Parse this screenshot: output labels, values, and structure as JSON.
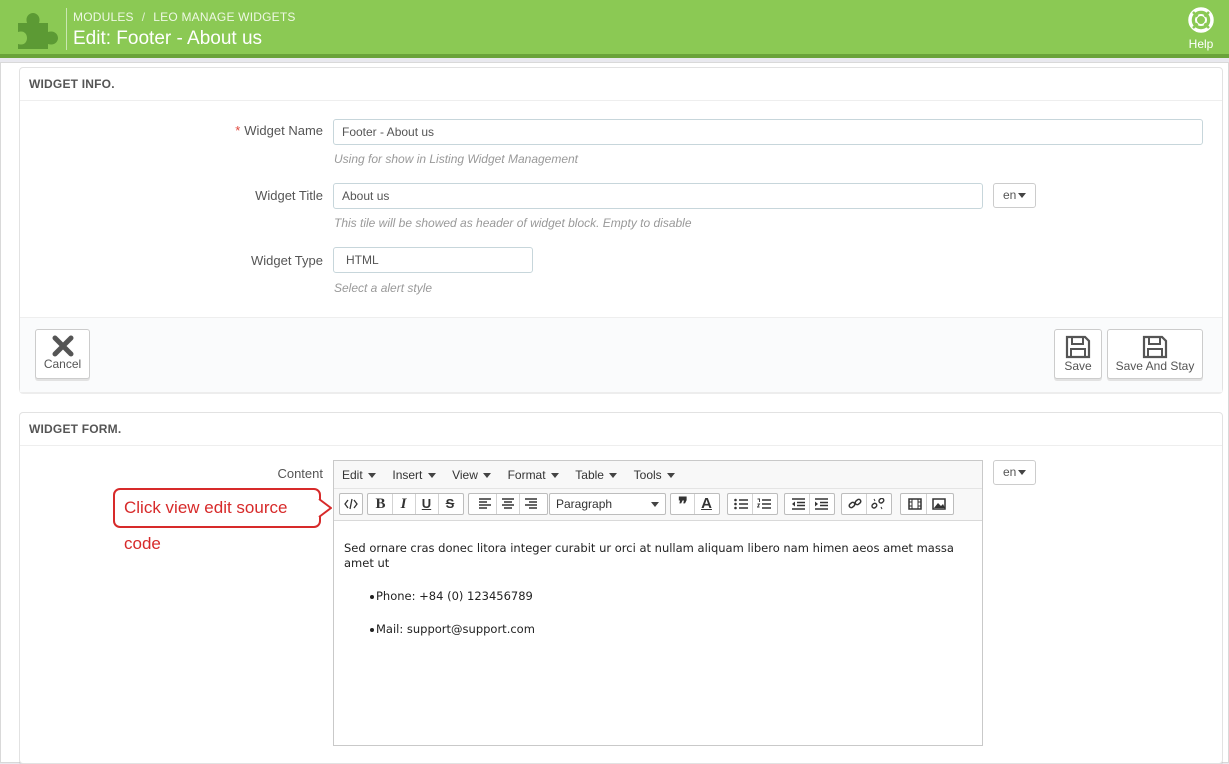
{
  "header": {
    "breadcrumb": [
      "MODULES",
      "LEO MANAGE WIDGETS"
    ],
    "breadcrumb_sep": "/",
    "title": "Edit: Footer - About us",
    "help_label": "Help",
    "bg_color": "#8bc954"
  },
  "widget_info": {
    "heading": "WIDGET INFO.",
    "name_label": "Widget Name",
    "name_required_mark": "*",
    "name_value": "Footer - About us",
    "name_hint": "Using for show in Listing Widget Management",
    "title_label": "Widget Title",
    "title_value": "About us",
    "title_lang": "en",
    "title_hint": "This tile will be showed as header of widget block. Empty to disable",
    "type_label": "Widget Type",
    "type_value": "HTML",
    "type_hint": "Select a alert style",
    "cancel_label": "Cancel",
    "save_label": "Save",
    "save_stay_label": "Save And Stay"
  },
  "widget_form": {
    "heading": "WIDGET FORM.",
    "content_label": "Content",
    "content_lang": "en",
    "menu": [
      "Edit",
      "Insert",
      "View",
      "Format",
      "Table",
      "Tools"
    ],
    "format_select": "Paragraph",
    "body_paragraph": "Sed ornare cras donec litora integer curabit ur orci at nullam aliquam libero nam himen aeos amet massa amet ut",
    "list_items": [
      "Phone: +84 (0) 123456789",
      "Mail: support@support.com"
    ]
  },
  "callout": {
    "text": "Click view edit source code",
    "color": "#d72a2a"
  }
}
